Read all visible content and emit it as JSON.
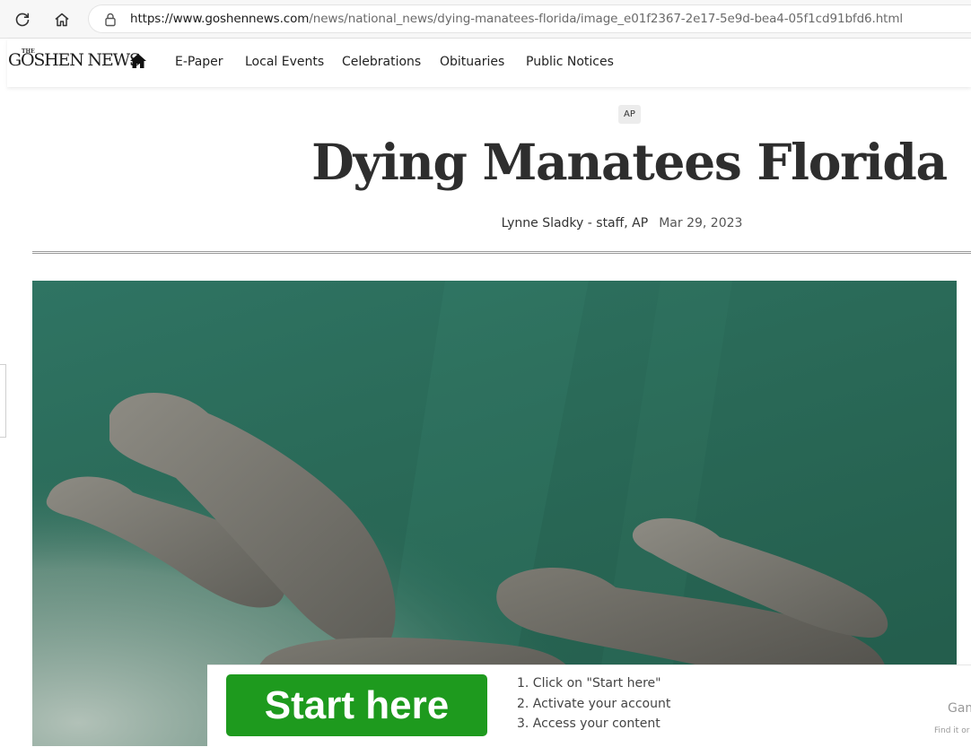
{
  "browser": {
    "url_domain": "https://www.goshennews.com",
    "url_path": "/news/national_news/dying-manatees-florida/image_e01f2367-2e17-5e9d-bea4-05f1cd91bfd6.html",
    "reload_icon": "reload-icon",
    "home_icon": "home-icon",
    "lock_icon": "lock-icon"
  },
  "site": {
    "logo_the": "THE",
    "logo_name": "GOSHEN NEWS",
    "nav": {
      "home_icon": "home-icon",
      "items": [
        {
          "label": "E-Paper"
        },
        {
          "label": "Local Events"
        },
        {
          "label": "Celebrations"
        },
        {
          "label": "Obituaries"
        },
        {
          "label": "Public Notices"
        }
      ]
    }
  },
  "article": {
    "badge": "AP",
    "headline": "Dying Manatees Florida",
    "author": "Lynne Sladky - staff, AP",
    "date": "Mar 29, 2023",
    "photo_subject": "manatees-in-water"
  },
  "ad": {
    "button_label": "Start here",
    "steps": [
      "1. Click on \"Start here\"",
      "2. Activate your account",
      "3. Access your content"
    ],
    "side_text": "Gam",
    "find_text": "Find it or"
  },
  "colors": {
    "water": "#2c6b5b",
    "ad_button": "#1e9a1e"
  }
}
